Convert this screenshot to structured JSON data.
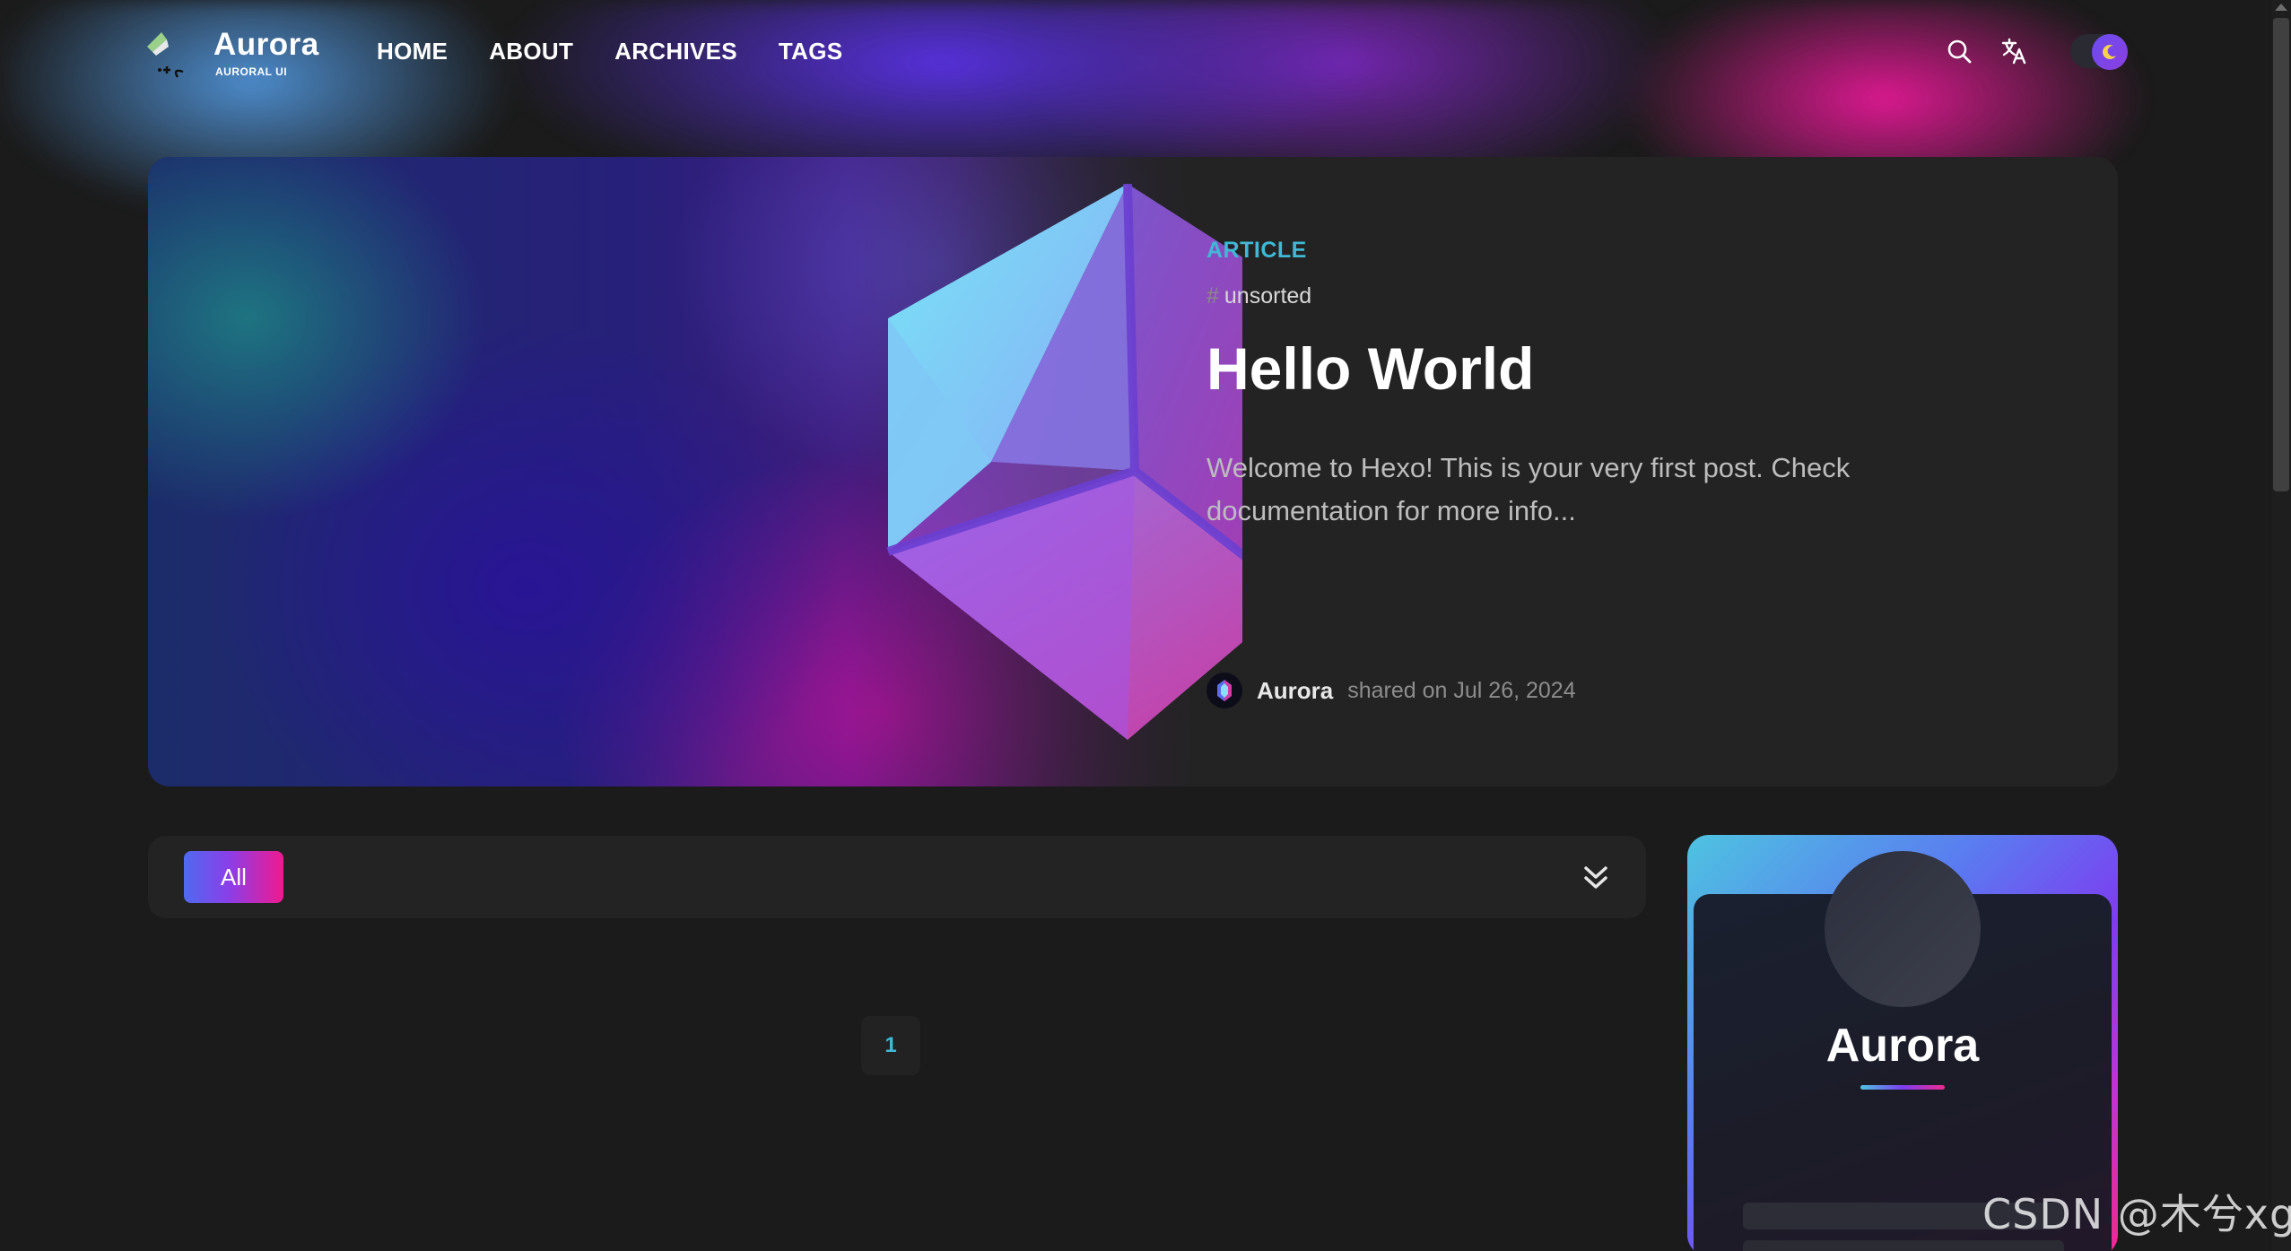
{
  "header": {
    "site_title": "Aurora",
    "site_subtitle": "AURORAL UI",
    "nav": [
      {
        "label": "HOME"
      },
      {
        "label": "ABOUT"
      },
      {
        "label": "ARCHIVES"
      },
      {
        "label": "TAGS"
      }
    ],
    "icons": {
      "search": "search-icon",
      "translate": "translate-icon",
      "theme_toggle": "moon-icon"
    }
  },
  "hero": {
    "kind": "ARTICLE",
    "tag_hash": "#",
    "tag": "unsorted",
    "title": "Hello World",
    "description": "Welcome to Hexo! This is your very first post. Check documentation for more info...",
    "author": "Aurora",
    "shared_text": "shared on Jul 26, 2024"
  },
  "categories": {
    "active": "All"
  },
  "pagination": {
    "current": "1"
  },
  "profile": {
    "name": "Aurora"
  },
  "watermark": "CSDN @木兮xg",
  "colors": {
    "accent_cyan": "#3fb9d6",
    "gradient_blue": "#4f6af0",
    "gradient_purple": "#8a3fe8",
    "gradient_pink": "#f0198f",
    "background": "#1b1b1b",
    "card": "#232323"
  }
}
